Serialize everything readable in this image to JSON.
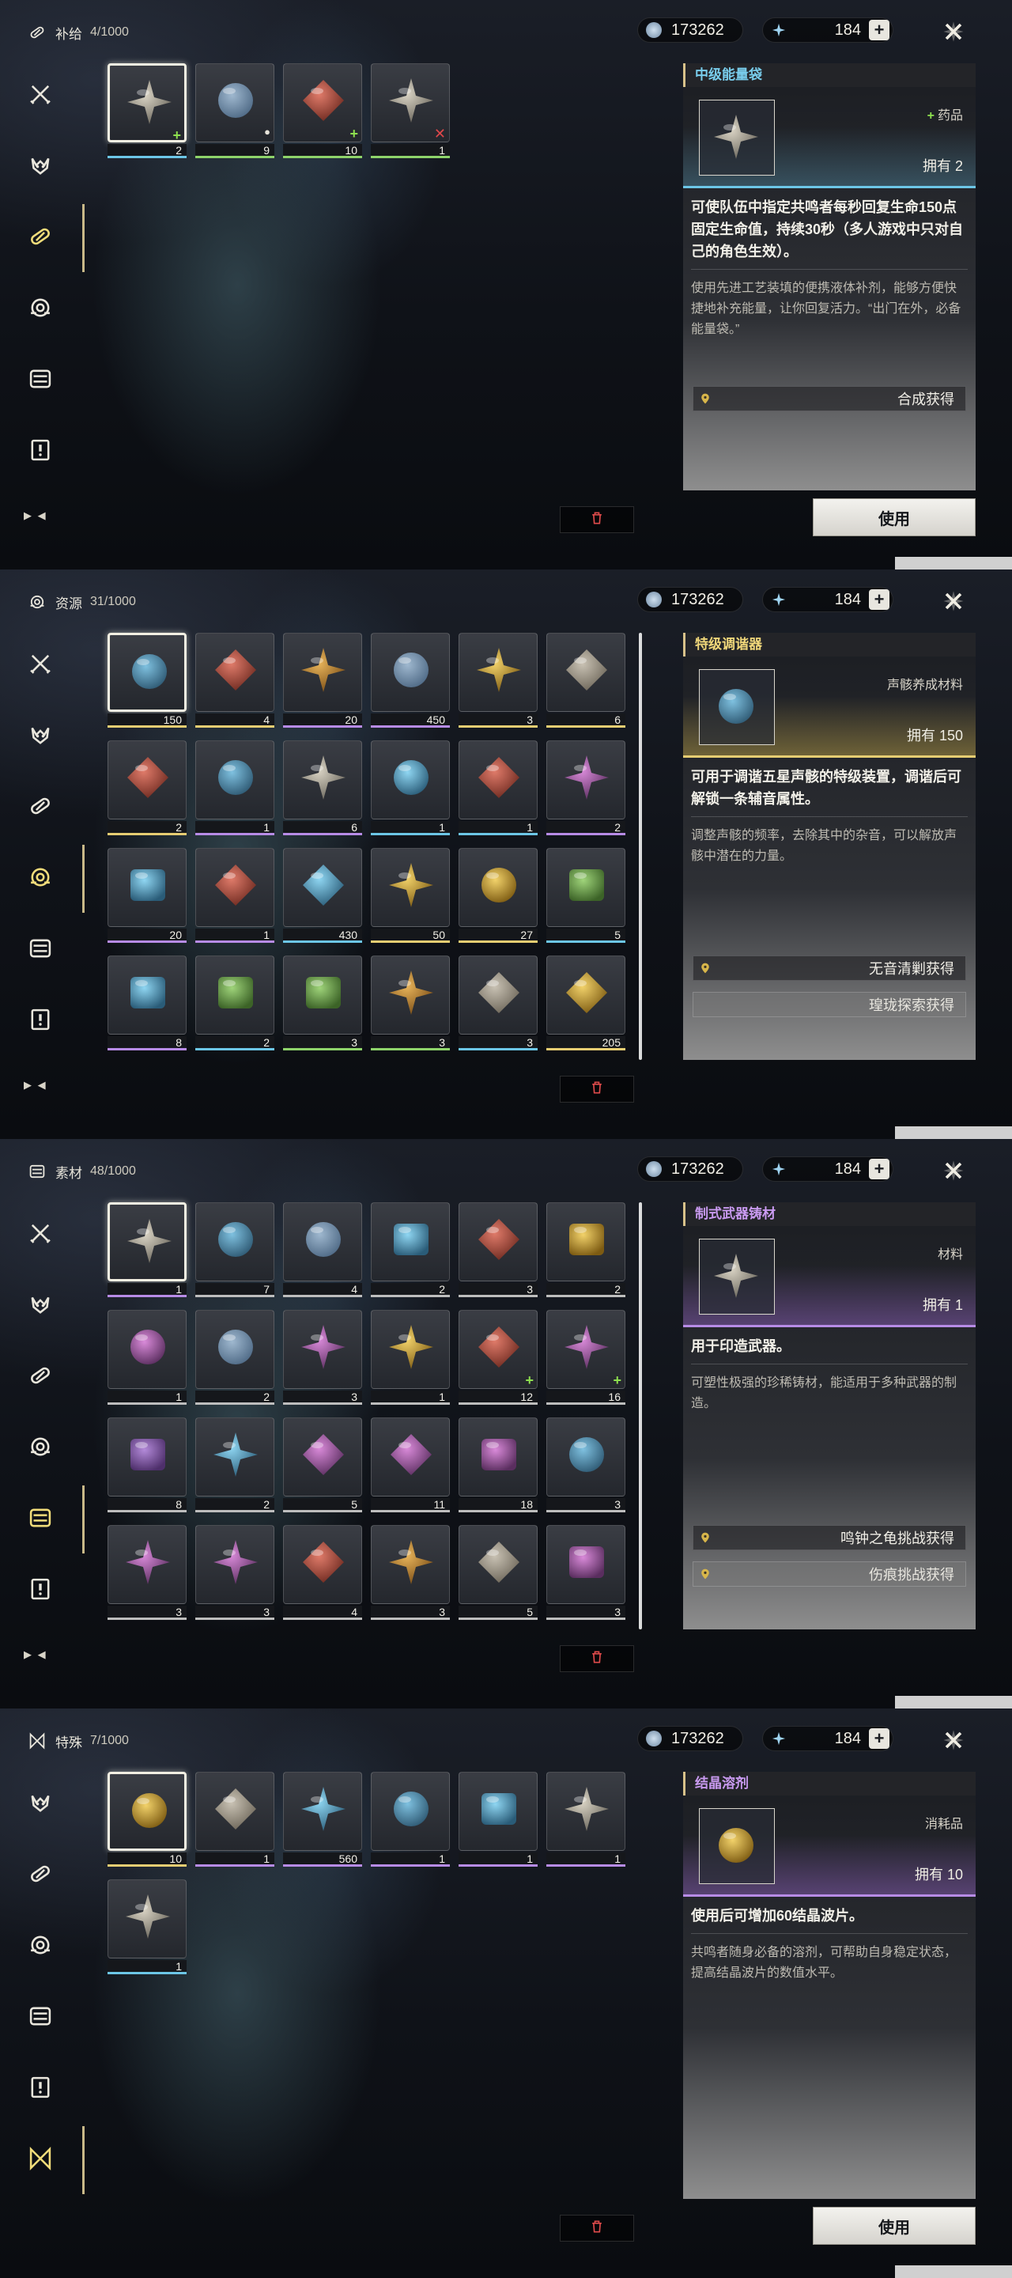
{
  "colors": {
    "accent_gold": "#d8c28a",
    "quality_green": "#8ed36a",
    "quality_blue": "#6cc6e6",
    "quality_purple": "#b78be6",
    "quality_gold": "#e6cd72"
  },
  "currency": {
    "shell_credit": "173262",
    "astrite": "184",
    "plus": "+"
  },
  "screens": [
    {
      "category": "补给",
      "count": "4/1000",
      "category_icon": "supply-icon",
      "active_side": 2,
      "items": [
        {
          "icon": "energy-bag-icon",
          "qty": "2",
          "quality": "blue",
          "badge": "+",
          "selected": true
        },
        {
          "icon": "bandage-icon",
          "qty": "9",
          "quality": "green",
          "badge": "lock"
        },
        {
          "icon": "pill-box-icon",
          "qty": "10",
          "quality": "green",
          "badge": "+"
        },
        {
          "icon": "skewer-icon",
          "qty": "1",
          "quality": "green",
          "badge": "x"
        }
      ],
      "detail": {
        "title": "中级能量袋",
        "type_plus": "+",
        "type": "药品",
        "owned": "拥有 2",
        "desc": "可使队伍中指定共鸣者每秒回复生命150点固定生命值，持续30秒（多人游戏中只对自己的角色生效）。",
        "lore": "使用先进工艺装填的便携液体补剂，能够方便快捷地补充能量，让你回复活力。“出门在外，必备能量袋。”",
        "sources": [
          "合成获得"
        ],
        "quality": "blue"
      },
      "use_button": "使用"
    },
    {
      "category": "资源",
      "count": "31/1000",
      "category_icon": "resource-icon",
      "active_side": 3,
      "items": [
        {
          "icon": "tuner-icon",
          "qty": "150",
          "quality": "gold",
          "selected": true
        },
        {
          "icon": "scroll-icon",
          "qty": "4",
          "quality": "gold"
        },
        {
          "icon": "capsule-icon",
          "qty": "20",
          "quality": "purple"
        },
        {
          "icon": "crystal-icon",
          "qty": "450",
          "quality": "purple"
        },
        {
          "icon": "star-shard-icon",
          "qty": "3",
          "quality": "gold"
        },
        {
          "icon": "orb-icon",
          "qty": "6",
          "quality": "gold"
        },
        {
          "icon": "spark-white-icon",
          "qty": "2",
          "quality": "gold"
        },
        {
          "icon": "spark-purple-icon",
          "qty": "1",
          "quality": "purple"
        },
        {
          "icon": "spark-red-icon",
          "qty": "6",
          "quality": "purple"
        },
        {
          "icon": "spark-blue-icon",
          "qty": "1",
          "quality": "blue"
        },
        {
          "icon": "rock-icon",
          "qty": "1",
          "quality": "blue"
        },
        {
          "icon": "spark-violet-icon",
          "qty": "2",
          "quality": "purple"
        },
        {
          "icon": "vial-icon",
          "qty": "20",
          "quality": "purple"
        },
        {
          "icon": "drill-icon",
          "qty": "1",
          "quality": "purple"
        },
        {
          "icon": "crystal-blue-icon",
          "qty": "430",
          "quality": "blue"
        },
        {
          "icon": "star-gold-icon",
          "qty": "50",
          "quality": "gold"
        },
        {
          "icon": "gold-orb-icon",
          "qty": "27",
          "quality": "gold"
        },
        {
          "icon": "ring-icon",
          "qty": "5",
          "quality": "blue"
        },
        {
          "icon": "mask-icon",
          "qty": "8",
          "quality": "purple"
        },
        {
          "icon": "tube-icon",
          "qty": "2",
          "quality": "blue"
        },
        {
          "icon": "shell-icon",
          "qty": "3",
          "quality": "green"
        },
        {
          "icon": "cone-icon",
          "qty": "3",
          "quality": "green"
        },
        {
          "icon": "eye-icon",
          "qty": "3",
          "quality": "blue"
        },
        {
          "icon": "star-orange-icon",
          "qty": "205",
          "quality": "gold"
        }
      ],
      "detail": {
        "title": "特级调谐器",
        "type_plus": "",
        "type": "声骸养成材料",
        "owned": "拥有 150",
        "desc": "可用于调谐五星声骸的特级装置，调谐后可解锁一条辅音属性。",
        "lore": "调整声骸的频率，去除其中的杂音，可以解放声骸中潜在的力量。",
        "sources": [
          "无音清剿获得",
          "瑝珑探索获得"
        ],
        "quality": "gold"
      },
      "use_button": ""
    },
    {
      "category": "素材",
      "count": "48/1000",
      "category_icon": "material-icon",
      "active_side": 4,
      "items": [
        {
          "icon": "ingot-icon",
          "qty": "1",
          "quality": "purple",
          "selected": true
        },
        {
          "icon": "bean-icon",
          "qty": "7",
          "quality": "white"
        },
        {
          "icon": "fruit-icon",
          "qty": "4",
          "quality": "white"
        },
        {
          "icon": "blue-flower-icon",
          "qty": "2",
          "quality": "white"
        },
        {
          "icon": "wrench-icon",
          "qty": "3",
          "quality": "white"
        },
        {
          "icon": "lantern-icon",
          "qty": "2",
          "quality": "white"
        },
        {
          "icon": "lily-icon",
          "qty": "1",
          "quality": "white"
        },
        {
          "icon": "mushroom-icon",
          "qty": "2",
          "quality": "white"
        },
        {
          "icon": "white-flower-icon",
          "qty": "3",
          "quality": "white"
        },
        {
          "icon": "gold-fruit-icon",
          "qty": "1",
          "quality": "white"
        },
        {
          "icon": "feather-icon",
          "qty": "12",
          "quality": "white",
          "badge": "+"
        },
        {
          "icon": "rose-icon",
          "qty": "16",
          "quality": "white",
          "badge": "+"
        },
        {
          "icon": "berry-icon",
          "qty": "8",
          "quality": "white"
        },
        {
          "icon": "ice-flower-icon",
          "qty": "2",
          "quality": "white"
        },
        {
          "icon": "iris-icon",
          "qty": "5",
          "quality": "white"
        },
        {
          "icon": "violet-icon",
          "qty": "11",
          "quality": "white"
        },
        {
          "icon": "white-lily-icon",
          "qty": "18",
          "quality": "white"
        },
        {
          "icon": "dandelion-icon",
          "qty": "3",
          "quality": "white"
        },
        {
          "icon": "glow-icon",
          "qty": "3",
          "quality": "white"
        },
        {
          "icon": "orchid-icon",
          "qty": "3",
          "quality": "white"
        },
        {
          "icon": "olive-icon",
          "qty": "4",
          "quality": "white"
        },
        {
          "icon": "clam-icon",
          "qty": "3",
          "quality": "white"
        },
        {
          "icon": "conch-icon",
          "qty": "5",
          "quality": "white"
        },
        {
          "icon": "morning-glory-icon",
          "qty": "3",
          "quality": "white"
        }
      ],
      "detail": {
        "title": "制式武器铸材",
        "type_plus": "",
        "type": "材料",
        "owned": "拥有 1",
        "desc": "用于印造武器。",
        "lore": "可塑性极强的珍稀铸材，能适用于多种武器的制造。",
        "sources": [
          "鸣钟之龟挑战获得",
          "伤痕挑战获得"
        ],
        "quality": "purple"
      },
      "use_button": ""
    },
    {
      "category": "特殊",
      "count": "7/1000",
      "category_icon": "special-icon",
      "active_side": 6,
      "items": [
        {
          "icon": "crystal-solvent-icon",
          "qty": "10",
          "quality": "gold",
          "selected": true
        },
        {
          "icon": "prism-icon",
          "qty": "1",
          "quality": "purple"
        },
        {
          "icon": "coral-icon",
          "qty": "560",
          "quality": "purple"
        },
        {
          "icon": "plank-icon",
          "qty": "1",
          "quality": "purple"
        },
        {
          "icon": "device-icon",
          "qty": "1",
          "quality": "purple"
        },
        {
          "icon": "camera-icon",
          "qty": "1",
          "quality": "purple"
        },
        {
          "icon": "notebook-icon",
          "qty": "1",
          "quality": "blue"
        }
      ],
      "detail": {
        "title": "结晶溶剂",
        "type_plus": "",
        "type": "消耗品",
        "owned": "拥有 10",
        "desc": "使用后可增加60结晶波片。",
        "lore": "共鸣者随身必备的溶剂，可帮助自身稳定状态，提高结晶波片的数值水平。",
        "sources": [],
        "quality": "purple"
      },
      "use_button": "使用"
    }
  ],
  "sidebar_icons": [
    "weapon-icon",
    "echo-icon",
    "supply-icon",
    "resource-icon",
    "material-icon",
    "quest-icon",
    "special-icon"
  ],
  "sidebar_more": "▶ ◀"
}
